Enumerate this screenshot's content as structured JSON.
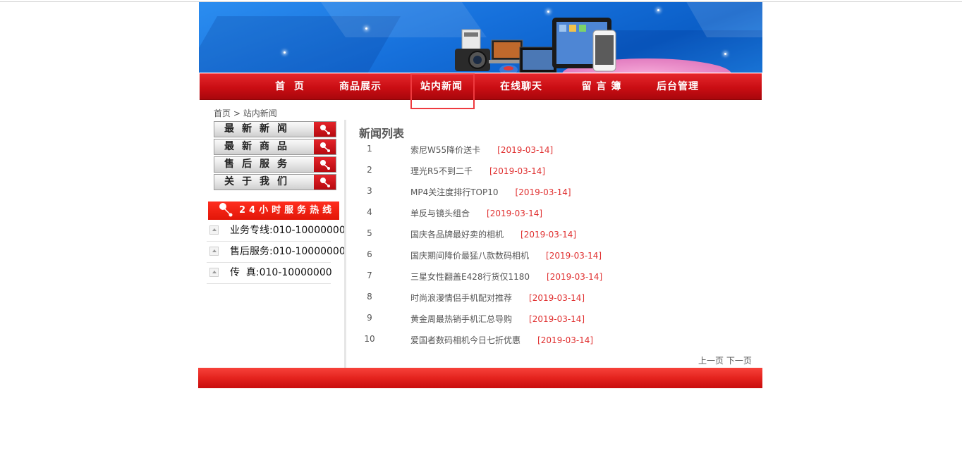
{
  "colors": {
    "nav_red": "#c90d13",
    "banner_blue": "#1670db",
    "date_red": "#e03030",
    "highlight": "#ee3a3f"
  },
  "nav": [
    {
      "label": "首  页"
    },
    {
      "label": "商品展示"
    },
    {
      "label": "站内新闻"
    },
    {
      "label": "在线聊天"
    },
    {
      "label": "留 言 簿"
    },
    {
      "label": "后台管理"
    }
  ],
  "breadcrumb": {
    "home": "首页",
    "sep": ">",
    "current": "站内新闻"
  },
  "side_menu": [
    {
      "label": "最新新闻"
    },
    {
      "label": "最新商品"
    },
    {
      "label": "售后服务"
    },
    {
      "label": "关于我们"
    }
  ],
  "hotline": {
    "title": "24小时服务热线",
    "items": [
      {
        "text": "业务专线:010-10000000"
      },
      {
        "text": "售后服务:010-10000000"
      },
      {
        "text": "传  真:010-10000000"
      }
    ]
  },
  "news": {
    "title": "新闻列表",
    "items": [
      {
        "num": "1",
        "title": "索尼W55降价送卡",
        "date": "[2019-03-14]"
      },
      {
        "num": "2",
        "title": "理光R5不到二千",
        "date": "[2019-03-14]"
      },
      {
        "num": "3",
        "title": "MP4关注度排行TOP10",
        "date": "[2019-03-14]"
      },
      {
        "num": "4",
        "title": "单反与镜头组合",
        "date": "[2019-03-14]"
      },
      {
        "num": "5",
        "title": "国庆各品牌最好卖的相机",
        "date": "[2019-03-14]"
      },
      {
        "num": "6",
        "title": "国庆期间降价最猛八款数码相机",
        "date": "[2019-03-14]"
      },
      {
        "num": "7",
        "title": "三星女性翻盖E428行货仅1180",
        "date": "[2019-03-14]"
      },
      {
        "num": "8",
        "title": "时尚浪漫情侣手机配对推荐",
        "date": "[2019-03-14]"
      },
      {
        "num": "9",
        "title": "黄金周最热销手机汇总导购",
        "date": "[2019-03-14]"
      },
      {
        "num": "10",
        "title": "爱国者数码相机今日七折优惠",
        "date": "[2019-03-14]"
      }
    ],
    "pager": {
      "prev": "上一页",
      "next": "下一页"
    }
  }
}
